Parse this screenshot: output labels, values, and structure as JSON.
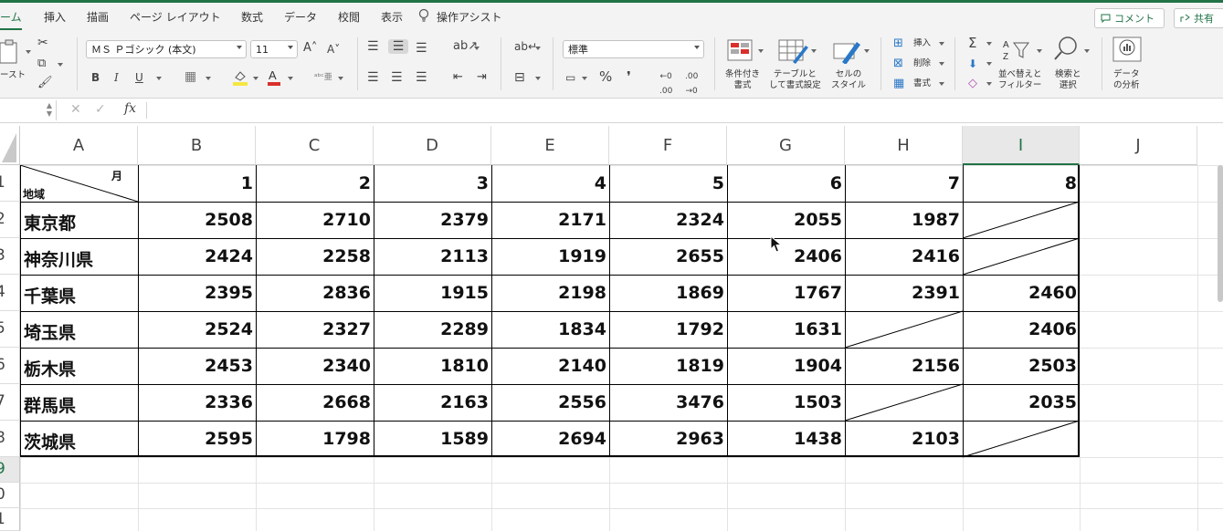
{
  "ribbon_tabs": [
    "ーム",
    "挿入",
    "描画",
    "ページ レイアウト",
    "数式",
    "データ",
    "校閲",
    "表示"
  ],
  "tell_me": "操作アシスト",
  "comment_button": "コメント",
  "share_button": "共有",
  "ribbon": {
    "paste_label": "ースト",
    "font_name": "ＭＳ Ｐゴシック (本文)",
    "font_size": "11",
    "number_format": "標準",
    "conditional_format": [
      "条件付き",
      "書式"
    ],
    "format_as_table": [
      "テーブルと",
      "して書式設定"
    ],
    "cell_styles": [
      "セルの",
      "スタイル"
    ],
    "insert": "挿入",
    "delete": "削除",
    "format": "書式",
    "sort_filter": [
      "並べ替えと",
      "フィルター"
    ],
    "find_select": [
      "検索と",
      "選択"
    ],
    "analyze_data": [
      "データ",
      "の分析"
    ]
  },
  "formula_bar": {
    "fx": "fx",
    "value": ""
  },
  "columns": [
    "A",
    "B",
    "C",
    "D",
    "E",
    "F",
    "G",
    "H",
    "I",
    "J"
  ],
  "selected_column": "I",
  "rows": [
    "1",
    "2",
    "3",
    "4",
    "5",
    "6",
    "7",
    "8",
    "9",
    "0",
    "1"
  ],
  "highlighted_row": "9",
  "header_cell": {
    "top_right": "月",
    "bottom_left": "地域"
  },
  "months": [
    "1",
    "2",
    "3",
    "4",
    "5",
    "6",
    "7",
    "8"
  ],
  "table": [
    {
      "region": "東京都",
      "values": [
        "2508",
        "2710",
        "2379",
        "2171",
        "2324",
        "2055",
        "1987",
        ""
      ]
    },
    {
      "region": "神奈川県",
      "values": [
        "2424",
        "2258",
        "2113",
        "1919",
        "2655",
        "2406",
        "2416",
        ""
      ]
    },
    {
      "region": "千葉県",
      "values": [
        "2395",
        "2836",
        "1915",
        "2198",
        "1869",
        "1767",
        "2391",
        "2460"
      ]
    },
    {
      "region": "埼玉県",
      "values": [
        "2524",
        "2327",
        "2289",
        "1834",
        "1792",
        "1631",
        "",
        "2406"
      ]
    },
    {
      "region": "栃木県",
      "values": [
        "2453",
        "2340",
        "1810",
        "2140",
        "1819",
        "1904",
        "2156",
        "2503"
      ]
    },
    {
      "region": "群馬県",
      "values": [
        "2336",
        "2668",
        "2163",
        "2556",
        "3476",
        "1503",
        "",
        "2035"
      ]
    },
    {
      "region": "茨城県",
      "values": [
        "2595",
        "1798",
        "1589",
        "2694",
        "2963",
        "1438",
        "2103",
        ""
      ]
    }
  ]
}
